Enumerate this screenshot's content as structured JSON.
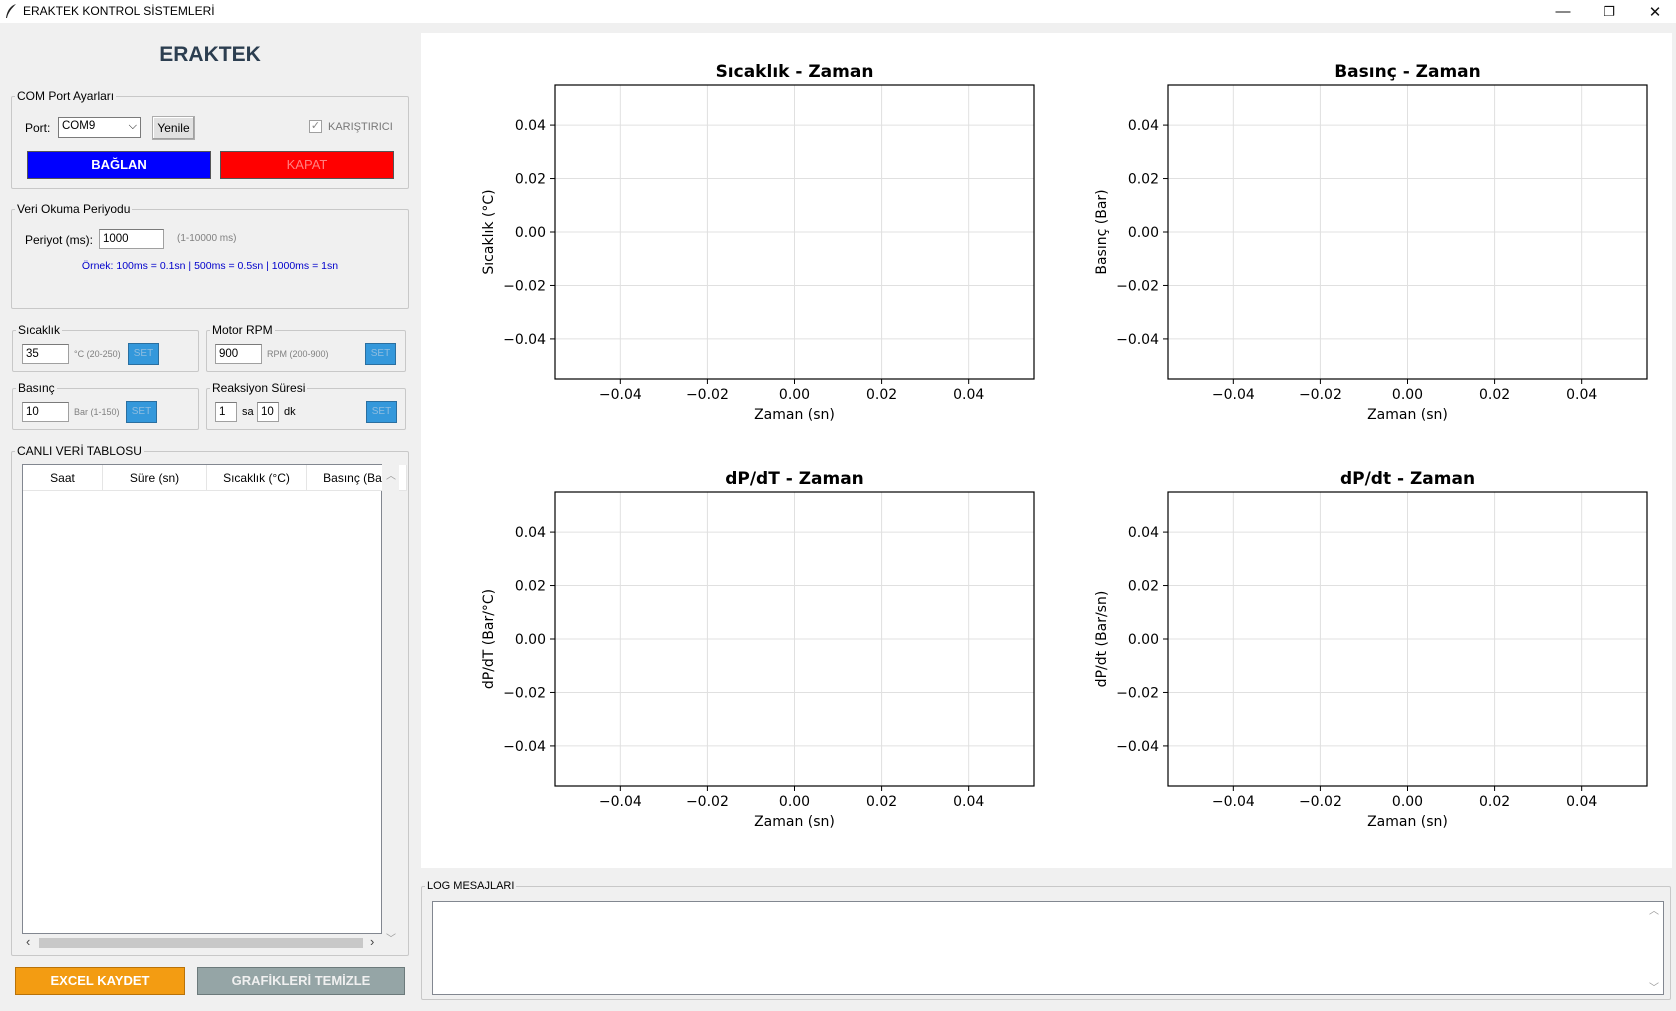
{
  "window": {
    "title": "ERAKTEK KONTROL SİSTEMLERİ",
    "minimize": "—",
    "restore": "❐",
    "close": "✕"
  },
  "brand": "ERAKTEK",
  "com": {
    "group_title": "COM Port Ayarları",
    "port_label": "Port:",
    "port_value": "COM9",
    "refresh_label": "Yenile",
    "mixer_label": "KARIŞTIRICI",
    "mixer_checked": true,
    "connect_label": "BAĞLAN",
    "close_label": "KAPAT",
    "connect_color": "#0000ff",
    "close_color": "#ff0000"
  },
  "period": {
    "group_title": "Veri Okuma Periyodu",
    "label": "Periyot (ms):",
    "value": "1000",
    "range": "(1-10000 ms)",
    "example": "Örnek: 100ms = 0.1sn | 500ms = 0.5sn | 1000ms = 1sn"
  },
  "temperature": {
    "group_title": "Sıcaklık",
    "value": "35",
    "range": "°C (20-250)",
    "set_label": "SET"
  },
  "motor": {
    "group_title": "Motor RPM",
    "value": "900",
    "range": "RPM (200-900)",
    "set_label": "SET"
  },
  "pressure": {
    "group_title": "Basınç",
    "value": "10",
    "range": "Bar (1-150)",
    "set_label": "SET"
  },
  "reaction": {
    "group_title": "Reaksiyon Süresi",
    "hours": "1",
    "hours_unit": "sa",
    "minutes": "10",
    "minutes_unit": "dk",
    "set_label": "SET"
  },
  "table": {
    "group_title": "CANLI VERİ TABLOSU",
    "columns": [
      "Saat",
      "Süre (sn)",
      "Sıcaklık (°C)",
      "Basınç (Bar)"
    ],
    "rows": []
  },
  "buttons": {
    "excel_label": "EXCEL KAYDET",
    "excel_color": "#f39c12",
    "clear_label": "GRAFİKLERİ TEMİZLE",
    "clear_color": "#95a5a6"
  },
  "log": {
    "group_title": "LOG MESAJLARI",
    "content": ""
  },
  "chart_data": [
    {
      "type": "line",
      "title": "Sıcaklık - Zaman",
      "xlabel": "Zaman (sn)",
      "ylabel": "Sıcaklık (°C)",
      "xlim": [
        -0.055,
        0.055
      ],
      "ylim": [
        -0.055,
        0.055
      ],
      "x_ticks": [
        "−0.04",
        "−0.02",
        "0.00",
        "0.02",
        "0.04"
      ],
      "y_ticks": [
        "0.04",
        "0.02",
        "0.00",
        "−0.02",
        "−0.04"
      ],
      "grid": true,
      "series": []
    },
    {
      "type": "line",
      "title": "Basınç - Zaman",
      "xlabel": "Zaman (sn)",
      "ylabel": "Basınç (Bar)",
      "xlim": [
        -0.055,
        0.055
      ],
      "ylim": [
        -0.055,
        0.055
      ],
      "x_ticks": [
        "−0.04",
        "−0.02",
        "0.00",
        "0.02",
        "0.04"
      ],
      "y_ticks": [
        "0.04",
        "0.02",
        "0.00",
        "−0.02",
        "−0.04"
      ],
      "grid": true,
      "series": []
    },
    {
      "type": "line",
      "title": "dP/dT - Zaman",
      "xlabel": "Zaman (sn)",
      "ylabel": "dP/dT (Bar/°C)",
      "xlim": [
        -0.055,
        0.055
      ],
      "ylim": [
        -0.055,
        0.055
      ],
      "x_ticks": [
        "−0.04",
        "−0.02",
        "0.00",
        "0.02",
        "0.04"
      ],
      "y_ticks": [
        "0.04",
        "0.02",
        "0.00",
        "−0.02",
        "−0.04"
      ],
      "grid": true,
      "series": []
    },
    {
      "type": "line",
      "title": "dP/dt - Zaman",
      "xlabel": "Zaman (sn)",
      "ylabel": "dP/dt (Bar/sn)",
      "xlim": [
        -0.055,
        0.055
      ],
      "ylim": [
        -0.055,
        0.055
      ],
      "x_ticks": [
        "−0.04",
        "−0.02",
        "0.00",
        "0.02",
        "0.04"
      ],
      "y_ticks": [
        "0.04",
        "0.02",
        "0.00",
        "−0.02",
        "−0.04"
      ],
      "grid": true,
      "series": []
    }
  ]
}
